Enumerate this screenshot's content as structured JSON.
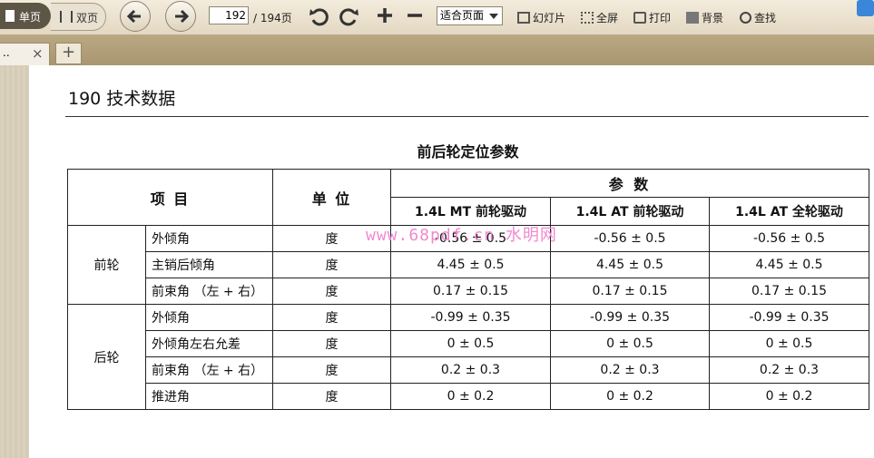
{
  "toolbar": {
    "single_page": "单页",
    "double_page": "双页",
    "current_page": "192",
    "total_pages": "/ 194页",
    "fit_mode": "适合页面",
    "slideshow": "幻灯片",
    "fullscreen": "全屏",
    "print": "打印",
    "background": "背景",
    "search": "查找"
  },
  "tabs": [
    {
      "label": "..",
      "close": "×"
    }
  ],
  "new_tab": "+",
  "page": {
    "header": "190 技术数据",
    "caption": "前后轮定位参数",
    "watermark": "www.68pdf.cn 水明网",
    "table": {
      "head_item": "项 目",
      "head_unit": "单 位",
      "head_params": "参 数",
      "columns": [
        "1.4L MT 前轮驱动",
        "1.4L AT 前轮驱动",
        "1.4L AT 全轮驱动"
      ],
      "groups": [
        {
          "name": "前轮",
          "rows": [
            {
              "item": "外倾角",
              "unit": "度",
              "values": [
                "-0.56 ± 0.5",
                "-0.56 ± 0.5",
                "-0.56 ± 0.5"
              ]
            },
            {
              "item": "主销后倾角",
              "unit": "度",
              "values": [
                "4.45 ± 0.5",
                "4.45 ± 0.5",
                "4.45 ± 0.5"
              ]
            },
            {
              "item": "前束角 （左 + 右）",
              "unit": "度",
              "values": [
                "0.17 ± 0.15",
                "0.17 ± 0.15",
                "0.17 ± 0.15"
              ]
            }
          ]
        },
        {
          "name": "后轮",
          "rows": [
            {
              "item": "外倾角",
              "unit": "度",
              "values": [
                "-0.99 ± 0.35",
                "-0.99 ± 0.35",
                "-0.99 ± 0.35"
              ]
            },
            {
              "item": "外倾角左右允差",
              "unit": "度",
              "values": [
                "0 ± 0.5",
                "0 ± 0.5",
                "0 ± 0.5"
              ]
            },
            {
              "item": "前束角 （左 + 右）",
              "unit": "度",
              "values": [
                "0.2 ± 0.3",
                "0.2 ± 0.3",
                "0.2 ± 0.3"
              ]
            },
            {
              "item": "推进角",
              "unit": "度",
              "values": [
                "0 ± 0.2",
                "0 ± 0.2",
                "0 ± 0.2"
              ]
            }
          ]
        }
      ]
    }
  }
}
